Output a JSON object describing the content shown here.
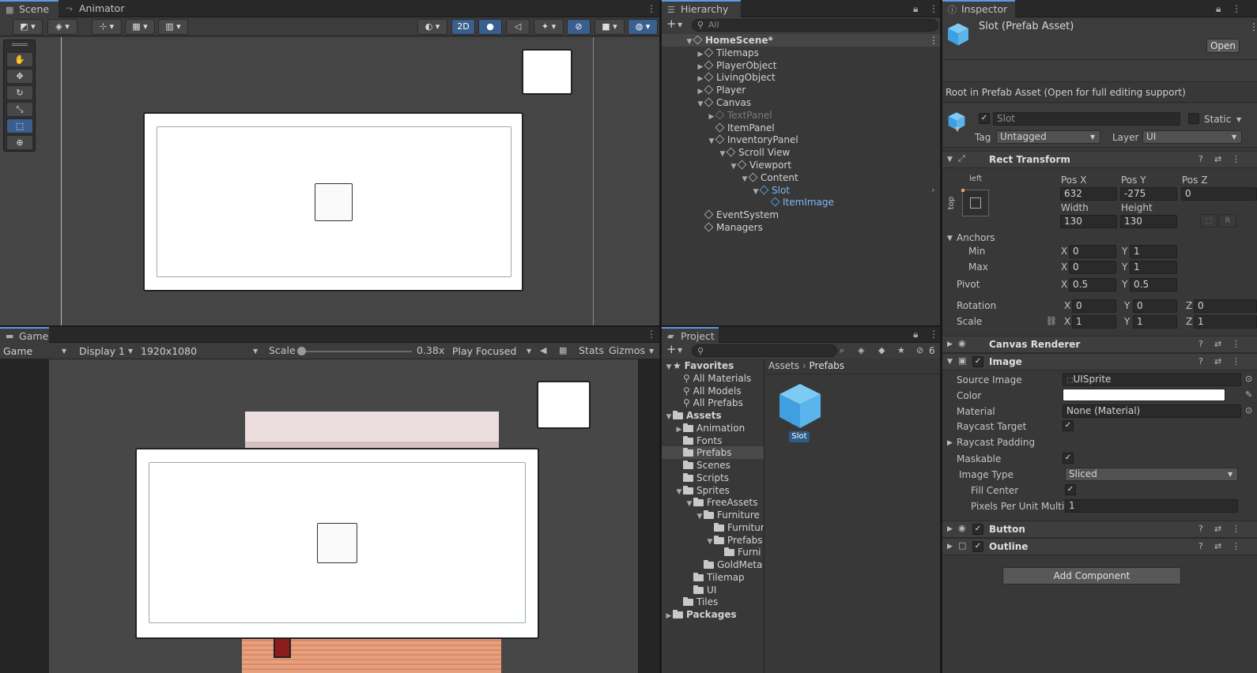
{
  "scene": {
    "tab_scene": "Scene",
    "tab_animator": "Animator",
    "btn_2d": "2D"
  },
  "game": {
    "tab": "Game",
    "mode": "Game",
    "display": "Display 1",
    "resolution": "1920x1080",
    "scale_label": "Scale",
    "scale_value": "0.38x",
    "play_mode": "Play Focused",
    "stats": "Stats",
    "gizmos": "Gizmos"
  },
  "hierarchy": {
    "tab": "Hierarchy",
    "search_placeholder": "All",
    "items": [
      {
        "label": "HomeScene*",
        "depth": 0,
        "arrow": "open",
        "selected": false,
        "dim": false,
        "prefab": false,
        "scene": true
      },
      {
        "label": "Tilemaps",
        "depth": 1,
        "arrow": "closed"
      },
      {
        "label": "PlayerObject",
        "depth": 1,
        "arrow": "closed"
      },
      {
        "label": "LivingObject",
        "depth": 1,
        "arrow": "closed"
      },
      {
        "label": "Player",
        "depth": 1,
        "arrow": "closed"
      },
      {
        "label": "Canvas",
        "depth": 1,
        "arrow": "open"
      },
      {
        "label": "TextPanel",
        "depth": 2,
        "arrow": "closed",
        "dim": true
      },
      {
        "label": "ItemPanel",
        "depth": 2,
        "arrow": "none"
      },
      {
        "label": "InventoryPanel",
        "depth": 2,
        "arrow": "open"
      },
      {
        "label": "Scroll View",
        "depth": 3,
        "arrow": "open"
      },
      {
        "label": "Viewport",
        "depth": 4,
        "arrow": "open"
      },
      {
        "label": "Content",
        "depth": 5,
        "arrow": "open"
      },
      {
        "label": "Slot",
        "depth": 6,
        "arrow": "open",
        "prefab": true
      },
      {
        "label": "ItemImage",
        "depth": 7,
        "arrow": "none",
        "prefab": true
      },
      {
        "label": "EventSystem",
        "depth": 1,
        "arrow": "none"
      },
      {
        "label": "Managers",
        "depth": 1,
        "arrow": "none"
      }
    ]
  },
  "project": {
    "tab": "Project",
    "hidden_count": "6",
    "breadcrumb": [
      "Assets",
      "Prefabs"
    ],
    "tree": [
      {
        "label": "Favorites",
        "depth": 0,
        "arrow": "open",
        "kind": "star",
        "bold": true
      },
      {
        "label": "All Materials",
        "depth": 1,
        "arrow": "none",
        "kind": "search"
      },
      {
        "label": "All Models",
        "depth": 1,
        "arrow": "none",
        "kind": "search"
      },
      {
        "label": "All Prefabs",
        "depth": 1,
        "arrow": "none",
        "kind": "search"
      },
      {
        "label": "Assets",
        "depth": 0,
        "arrow": "open",
        "kind": "folder",
        "bold": true
      },
      {
        "label": "Animation",
        "depth": 1,
        "arrow": "closed",
        "kind": "folder"
      },
      {
        "label": "Fonts",
        "depth": 1,
        "arrow": "none",
        "kind": "folder"
      },
      {
        "label": "Prefabs",
        "depth": 1,
        "arrow": "none",
        "kind": "folder",
        "selected": true
      },
      {
        "label": "Scenes",
        "depth": 1,
        "arrow": "none",
        "kind": "folder"
      },
      {
        "label": "Scripts",
        "depth": 1,
        "arrow": "none",
        "kind": "folder"
      },
      {
        "label": "Sprites",
        "depth": 1,
        "arrow": "open",
        "kind": "folder"
      },
      {
        "label": "FreeAssets",
        "depth": 2,
        "arrow": "open",
        "kind": "folder"
      },
      {
        "label": "Furniture",
        "depth": 3,
        "arrow": "open",
        "kind": "folder"
      },
      {
        "label": "Furnitur",
        "depth": 4,
        "arrow": "none",
        "kind": "folder"
      },
      {
        "label": "Prefabs",
        "depth": 4,
        "arrow": "open",
        "kind": "folder"
      },
      {
        "label": "Furni",
        "depth": 5,
        "arrow": "none",
        "kind": "folder"
      },
      {
        "label": "GoldMeta",
        "depth": 3,
        "arrow": "none",
        "kind": "folder"
      },
      {
        "label": "Tilemap",
        "depth": 2,
        "arrow": "none",
        "kind": "folder"
      },
      {
        "label": "UI",
        "depth": 2,
        "arrow": "none",
        "kind": "folder"
      },
      {
        "label": "Tiles",
        "depth": 1,
        "arrow": "none",
        "kind": "folder"
      },
      {
        "label": "Packages",
        "depth": 0,
        "arrow": "closed",
        "kind": "folder",
        "bold": true
      }
    ],
    "asset_label": "Slot"
  },
  "inspector": {
    "tab": "Inspector",
    "title": "Slot (Prefab Asset)",
    "open_button": "Open",
    "root_note": "Root in Prefab Asset (Open for full editing support)",
    "name": "Slot",
    "static_label": "Static",
    "tag_label": "Tag",
    "tag_value": "Untagged",
    "layer_label": "Layer",
    "layer_value": "UI",
    "rect_transform": {
      "title": "Rect Transform",
      "anchor_h": "left",
      "anchor_v": "top",
      "pos_x_label": "Pos X",
      "pos_x": "632",
      "pos_y_label": "Pos Y",
      "pos_y": "-275",
      "pos_z_label": "Pos Z",
      "pos_z": "0",
      "width_label": "Width",
      "width": "130",
      "height_label": "Height",
      "height": "130",
      "r_button": "R",
      "anchors_label": "Anchors",
      "min_label": "Min",
      "min_x": "0",
      "min_y": "1",
      "max_label": "Max",
      "max_x": "0",
      "max_y": "1",
      "pivot_label": "Pivot",
      "pivot_x": "0.5",
      "pivot_y": "0.5",
      "rotation_label": "Rotation",
      "rot_x": "0",
      "rot_y": "0",
      "rot_z": "0",
      "scale_label": "Scale",
      "scale_x": "1",
      "scale_y": "1",
      "scale_z": "1",
      "axis_x": "X",
      "axis_y": "Y",
      "axis_z": "Z"
    },
    "canvas_renderer": {
      "title": "Canvas Renderer"
    },
    "image": {
      "title": "Image",
      "source_image_label": "Source Image",
      "source_image": "UISprite",
      "color_label": "Color",
      "color": "#ffffff",
      "material_label": "Material",
      "material": "None (Material)",
      "raycast_target_label": "Raycast Target",
      "raycast_padding_label": "Raycast Padding",
      "maskable_label": "Maskable",
      "image_type_label": "Image Type",
      "image_type": "Sliced",
      "fill_center_label": "Fill Center",
      "ppu_label": "Pixels Per Unit Multip",
      "ppu": "1"
    },
    "button": {
      "title": "Button"
    },
    "outline": {
      "title": "Outline"
    },
    "add_component": "Add Component"
  }
}
